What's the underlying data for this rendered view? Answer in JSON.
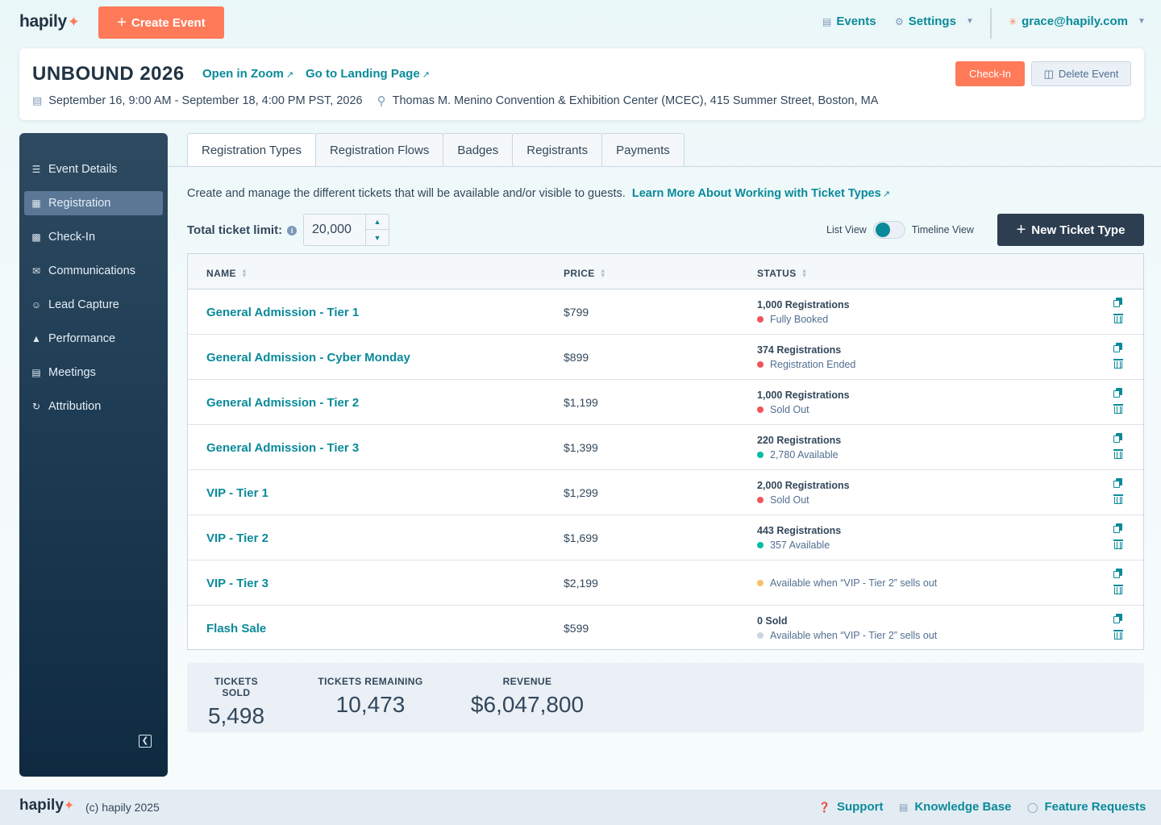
{
  "brand": {
    "name": "hapily",
    "flame": "🔥",
    "accent": "#ff7a59",
    "link_color": "#0a8a9a"
  },
  "topbar": {
    "create_label": "Create Event",
    "events_label": "Events",
    "settings_label": "Settings",
    "user_email": "grace@hapily.com"
  },
  "event": {
    "title": "UNBOUND 2026",
    "zoom_link": "Open in Zoom",
    "landing_link": "Go to Landing Page",
    "dates": "September 16, 9:00 AM - September 18, 4:00 PM PST, 2026",
    "location": "Thomas M. Menino Convention & Exhibition Center (MCEC), 415 Summer Street, Boston, MA",
    "checkin_label": "Check-In",
    "delete_label": "Delete Event"
  },
  "sidebar": {
    "items": [
      {
        "label": "Event Details",
        "icon": "list-icon"
      },
      {
        "label": "Registration",
        "icon": "ticket-icon"
      },
      {
        "label": "Check-In",
        "icon": "qr-icon"
      },
      {
        "label": "Communications",
        "icon": "mail-icon"
      },
      {
        "label": "Lead Capture",
        "icon": "user-icon"
      },
      {
        "label": "Performance",
        "icon": "chart-icon"
      },
      {
        "label": "Meetings",
        "icon": "calendar-icon"
      },
      {
        "label": "Attribution",
        "icon": "route-icon"
      }
    ],
    "active_index": 1
  },
  "tabs": [
    "Registration Types",
    "Registration Flows",
    "Badges",
    "Registrants",
    "Payments"
  ],
  "intro": {
    "text": "Create and manage the different tickets that will be available and/or visible to guests.",
    "link": "Learn More About Working with Ticket Types"
  },
  "limit": {
    "label": "Total ticket limit:",
    "value": "20,000"
  },
  "view": {
    "list_label": "List View",
    "timeline_label": "Timeline View"
  },
  "new_ticket_label": "New Ticket Type",
  "table": {
    "headers": {
      "name": "NAME",
      "price": "PRICE",
      "status": "STATUS"
    },
    "rows": [
      {
        "name": "General Admission - Tier 1",
        "price": "$799",
        "count": "1,000 Registrations",
        "status": "Fully Booked",
        "dot": "#f2545b"
      },
      {
        "name": "General Admission - Cyber Monday",
        "price": "$899",
        "count": "374 Registrations",
        "status": "Registration Ended",
        "dot": "#f2545b"
      },
      {
        "name": "General Admission - Tier 2",
        "price": "$1,199",
        "count": "1,000 Registrations",
        "status": "Sold Out",
        "dot": "#f2545b"
      },
      {
        "name": "General Admission - Tier 3",
        "price": "$1,399",
        "count": "220 Registrations",
        "status": "2,780 Available",
        "dot": "#00bda5"
      },
      {
        "name": "VIP - Tier 1",
        "price": "$1,299",
        "count": "2,000 Registrations",
        "status": "Sold Out",
        "dot": "#f2545b"
      },
      {
        "name": "VIP - Tier 2",
        "price": "$1,699",
        "count": "443 Registrations",
        "status": "357 Available",
        "dot": "#00bda5"
      },
      {
        "name": "VIP - Tier 3",
        "price": "$2,199",
        "count": "",
        "status": "Available when “VIP - Tier 2” sells out",
        "dot": "#f5c26b"
      },
      {
        "name": "Flash Sale",
        "price": "$599",
        "count": "0 Sold",
        "status": "Available when “VIP - Tier 2” sells out",
        "dot": "#cbd6e2"
      }
    ]
  },
  "stats": {
    "sold_label": "TICKETS SOLD",
    "sold": "5,498",
    "remaining_label": "TICKETS REMAINING",
    "remaining": "10,473",
    "revenue_label": "REVENUE",
    "revenue": "$6,047,800"
  },
  "footer": {
    "copyright": "(c) hapily 2025",
    "support": "Support",
    "kb": "Knowledge Base",
    "features": "Feature Requests"
  }
}
